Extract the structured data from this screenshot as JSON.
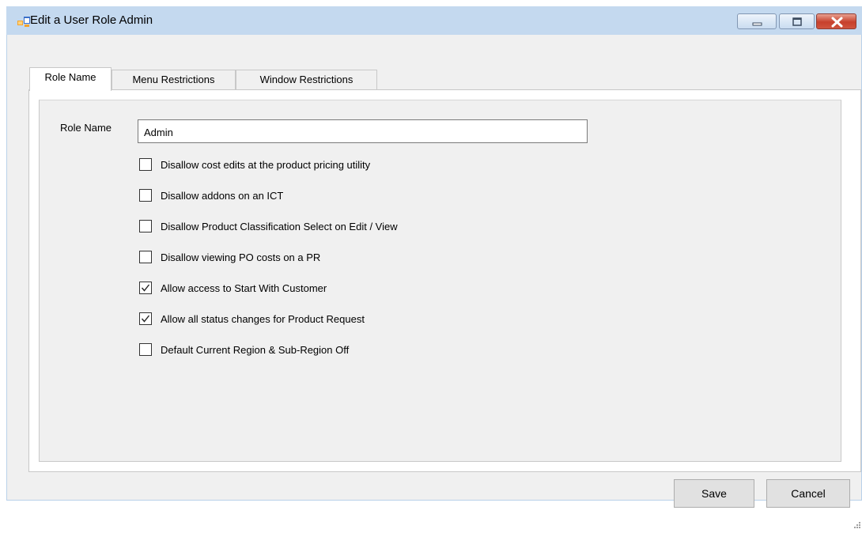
{
  "window": {
    "title": "Edit a User Role Admin"
  },
  "tabs": [
    {
      "label": "Role Name",
      "active": true
    },
    {
      "label": "Menu Restrictions",
      "active": false
    },
    {
      "label": "Window Restrictions",
      "active": false
    }
  ],
  "form": {
    "role_name_label": "Role Name",
    "role_name_value": "Admin",
    "options": [
      {
        "label": "Disallow cost edits at the product pricing utility",
        "checked": false
      },
      {
        "label": "Disallow addons on an ICT",
        "checked": false
      },
      {
        "label": "Disallow Product Classification Select on Edit / View",
        "checked": false
      },
      {
        "label": "Disallow viewing PO costs on a PR",
        "checked": false
      },
      {
        "label": "Allow access to Start With Customer",
        "checked": true
      },
      {
        "label": "Allow all status changes for Product Request",
        "checked": true
      },
      {
        "label": "Default Current Region & Sub-Region Off",
        "checked": false
      }
    ]
  },
  "buttons": {
    "save": "Save",
    "cancel": "Cancel"
  },
  "icons": {
    "app": "window-app-icon",
    "minimize": "minimize-icon",
    "maximize": "maximize-icon",
    "close": "close-icon",
    "checkmark": "checkmark-icon",
    "resize_grip": "resize-grip-icon"
  },
  "colors": {
    "titlebar": "#c4d9ef",
    "client": "#f0f0f0",
    "close_button": "#c7402c",
    "app_icon_orange": "#f4a32c",
    "app_icon_blue": "#3a6fc9"
  }
}
